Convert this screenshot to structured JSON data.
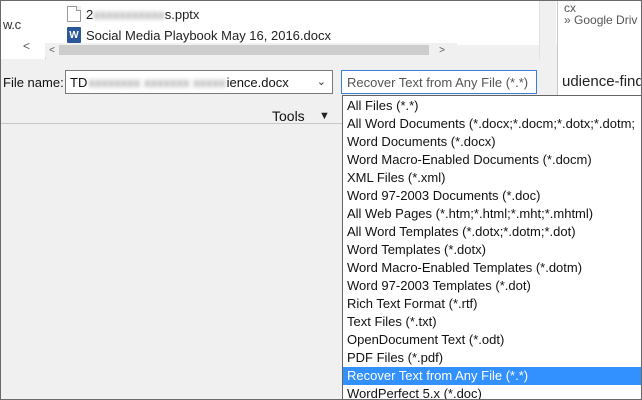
{
  "left_strip": {
    "text": "w.c",
    "arrow": "<"
  },
  "file_list": {
    "items": [
      {
        "name_visible": "2",
        "name_blurred": "xxxxxxxxxxx",
        "name_suffix": "s.pptx",
        "icon": "document-icon"
      },
      {
        "name_visible": "Social Media Playbook May 16, 2016.docx",
        "icon": "word-document-icon"
      }
    ]
  },
  "scrollbar": {
    "left_arrow": "<",
    "right_arrow": ">"
  },
  "right_pane": {
    "line1": "cx",
    "line2": "» Google Driv",
    "line3": "udience-find"
  },
  "save_form": {
    "file_name_label": "File name:",
    "file_name_prefix": "TD",
    "file_name_blurred": "xxxxxxxx xxxxxxx xxxxx",
    "file_name_suffix": "ience.docx",
    "file_type_current": "Recover Text from Any File (*.*)",
    "tools_label": "Tools"
  },
  "file_type_options": [
    "All Files (*.*)",
    "All Word Documents (*.docx;*.docm;*.dotx;*.dotm;",
    "Word Documents (*.docx)",
    "Word Macro-Enabled Documents (*.docm)",
    "XML Files (*.xml)",
    "Word 97-2003 Documents (*.doc)",
    "All Web Pages (*.htm;*.html;*.mht;*.mhtml)",
    "All Word Templates (*.dotx;*.dotm;*.dot)",
    "Word Templates (*.dotx)",
    "Word Macro-Enabled Templates (*.dotm)",
    "Word 97-2003 Templates (*.dot)",
    "Rich Text Format (*.rtf)",
    "Text Files (*.txt)",
    "OpenDocument Text (*.odt)",
    "PDF Files (*.pdf)",
    "Recover Text from Any File (*.*)",
    "WordPerfect 5.x (*.doc)"
  ],
  "selected_option_index": 15,
  "colors": {
    "selection_blue": "#3390ff",
    "focus_border": "#3c7fd1",
    "word_blue": "#2b579a"
  }
}
